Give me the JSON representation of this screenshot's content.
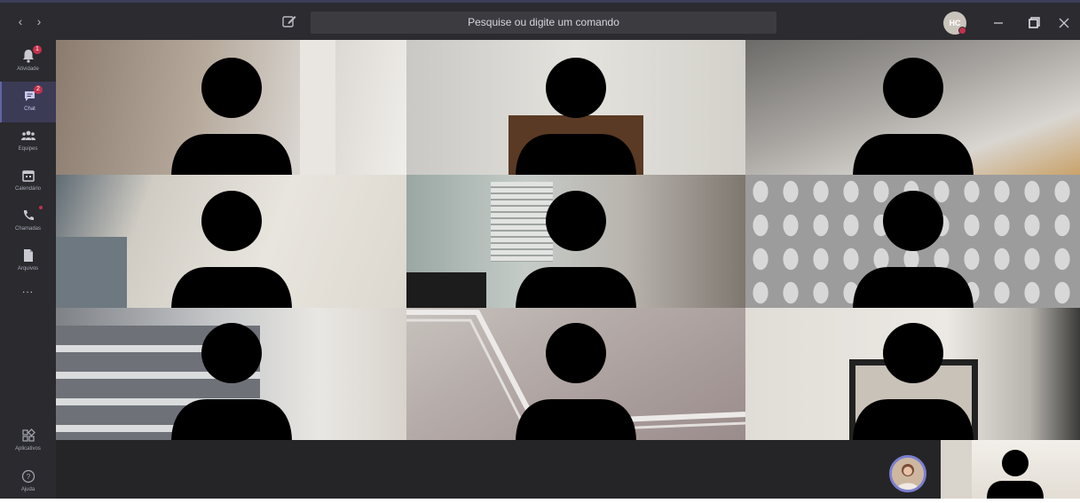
{
  "titlebar": {
    "search_placeholder": "Pesquise ou digite um comando",
    "user_initials": "HC"
  },
  "rail": {
    "items": [
      {
        "label": "Atividade",
        "icon": "bell-icon",
        "badge": "1"
      },
      {
        "label": "Chat",
        "icon": "chat-icon",
        "badge": "2",
        "active": true
      },
      {
        "label": "Equipes",
        "icon": "teams-icon"
      },
      {
        "label": "Calendário",
        "icon": "calendar-icon"
      },
      {
        "label": "Chamadas",
        "icon": "phone-icon",
        "dot": true
      },
      {
        "label": "Arquivos",
        "icon": "files-icon"
      },
      {
        "label": "...",
        "icon": "more-icon"
      }
    ],
    "bottom_items": [
      {
        "label": "Aplicativos",
        "icon": "apps-icon"
      },
      {
        "label": "Ajuda",
        "icon": "help-icon"
      }
    ]
  },
  "colors": {
    "accent": "#6264a7",
    "rail_bg": "#2a2a2f",
    "title_bg": "#2b2b30",
    "badge": "#c4314b"
  },
  "video_grid": {
    "rows": 3,
    "columns": 3,
    "participants": 9
  }
}
